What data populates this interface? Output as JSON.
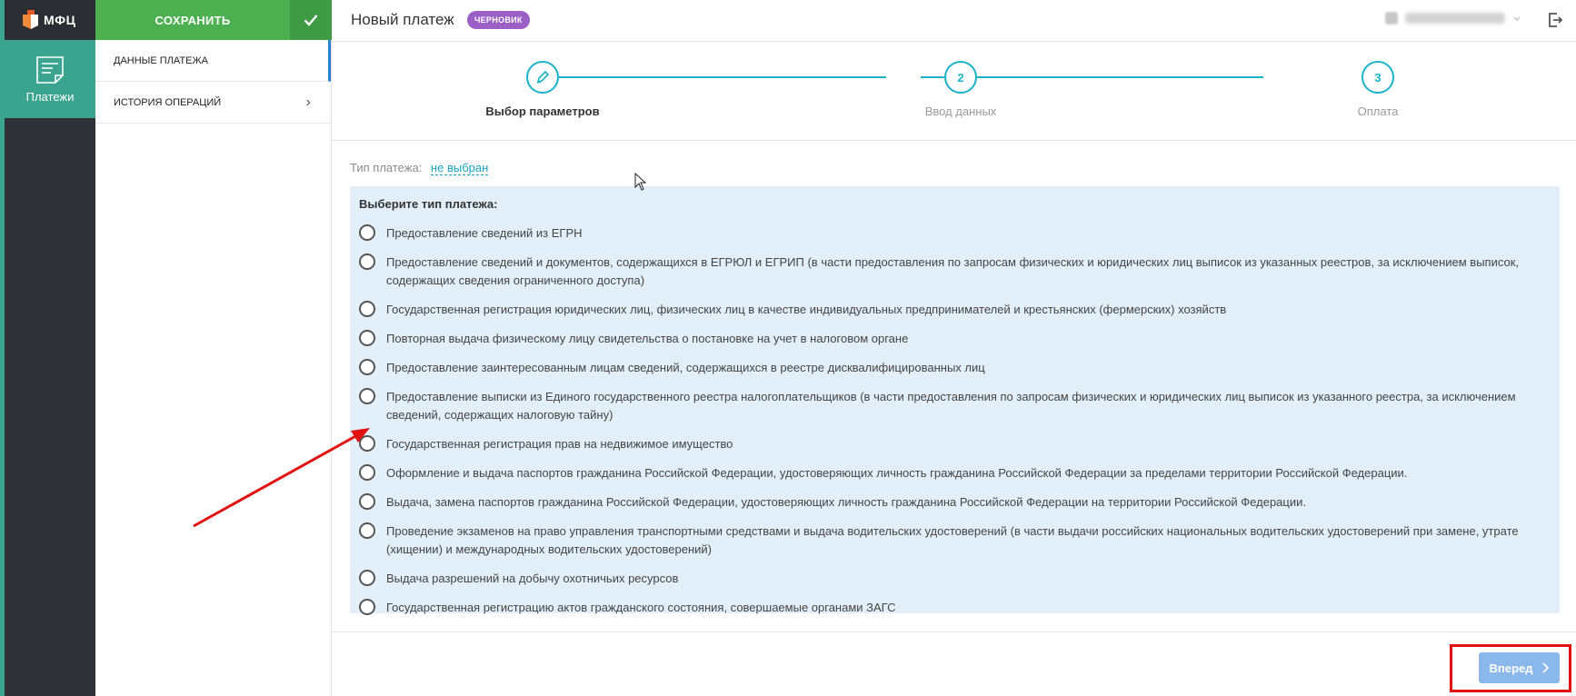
{
  "app": {
    "logo_text": "МФЦ",
    "rail_item_label": "Платежи"
  },
  "sidebar": {
    "save_label": "СОХРАНИТЬ",
    "items": [
      {
        "label": "ДАННЫЕ ПЛАТЕЖА",
        "active": true
      },
      {
        "label": "ИСТОРИЯ ОПЕРАЦИЙ",
        "chevron": "›"
      }
    ]
  },
  "header": {
    "title": "Новый платеж",
    "badge": "ЧЕРНОВИК"
  },
  "stepper": {
    "steps": [
      {
        "number": "",
        "label": "Выбор параметров",
        "icon": "pencil-icon",
        "current": true
      },
      {
        "number": "2",
        "label": "Ввод данных"
      },
      {
        "number": "3",
        "label": "Оплата"
      }
    ]
  },
  "form": {
    "type_label": "Тип платежа:",
    "type_value": "не выбран",
    "panel_title": "Выберите тип платежа:",
    "options": [
      "Предоставление сведений из ЕГРН",
      "Предоставление сведений и документов, содержащихся в ЕГРЮЛ и ЕГРИП (в части предоставления по запросам физических и юридических лиц выписок из указанных реестров, за исключением выписок, содержащих сведения ограниченного доступа)",
      "Государственная регистрация юридических лиц, физических лиц в качестве индивидуальных предпринимателей и крестьянских (фермерских) хозяйств",
      "Повторная выдача физическому лицу свидетельства о постановке на учет в налоговом органе",
      "Предоставление заинтересованным лицам сведений, содержащихся в реестре дисквалифицированных лиц",
      "Предоставление выписки из Единого государственного реестра налогоплательщиков (в части предоставления по запросам физических и юридических лиц выписок из указанного реестра, за исключением сведений, содержащих налоговую тайну)",
      "Государственная регистрация прав на недвижимое имущество",
      "Оформление и выдача паспортов гражданина Российской Федерации, удостоверяющих личность гражданина Российской Федерации за пределами территории Российской Федерации.",
      "Выдача, замена паспортов гражданина Российской Федерации, удостоверяющих личность гражданина Российской Федерации на территории Российской Федерации.",
      "Проведение экзаменов на право управления транспортными средствами и выдача водительских удостоверений (в части выдачи российских национальных водительских удостоверений при замене, утрате (хищении) и международных водительских удостоверений)",
      "Выдача разрешений на добычу охотничьих ресурсов",
      "Государственная регистрацию актов гражданского состояния, совершаемые органами ЗАГС"
    ]
  },
  "footer": {
    "next_label": "Вперед"
  },
  "colors": {
    "accent_green": "#4cb050",
    "rail_teal": "#3aa48e",
    "stepper_cyan": "#1bb3c9",
    "badge_purple": "#9b5fc6",
    "panel_bg": "#e2eff9",
    "annotation_red": "#e31212",
    "next_button": "#8ab8ea"
  }
}
